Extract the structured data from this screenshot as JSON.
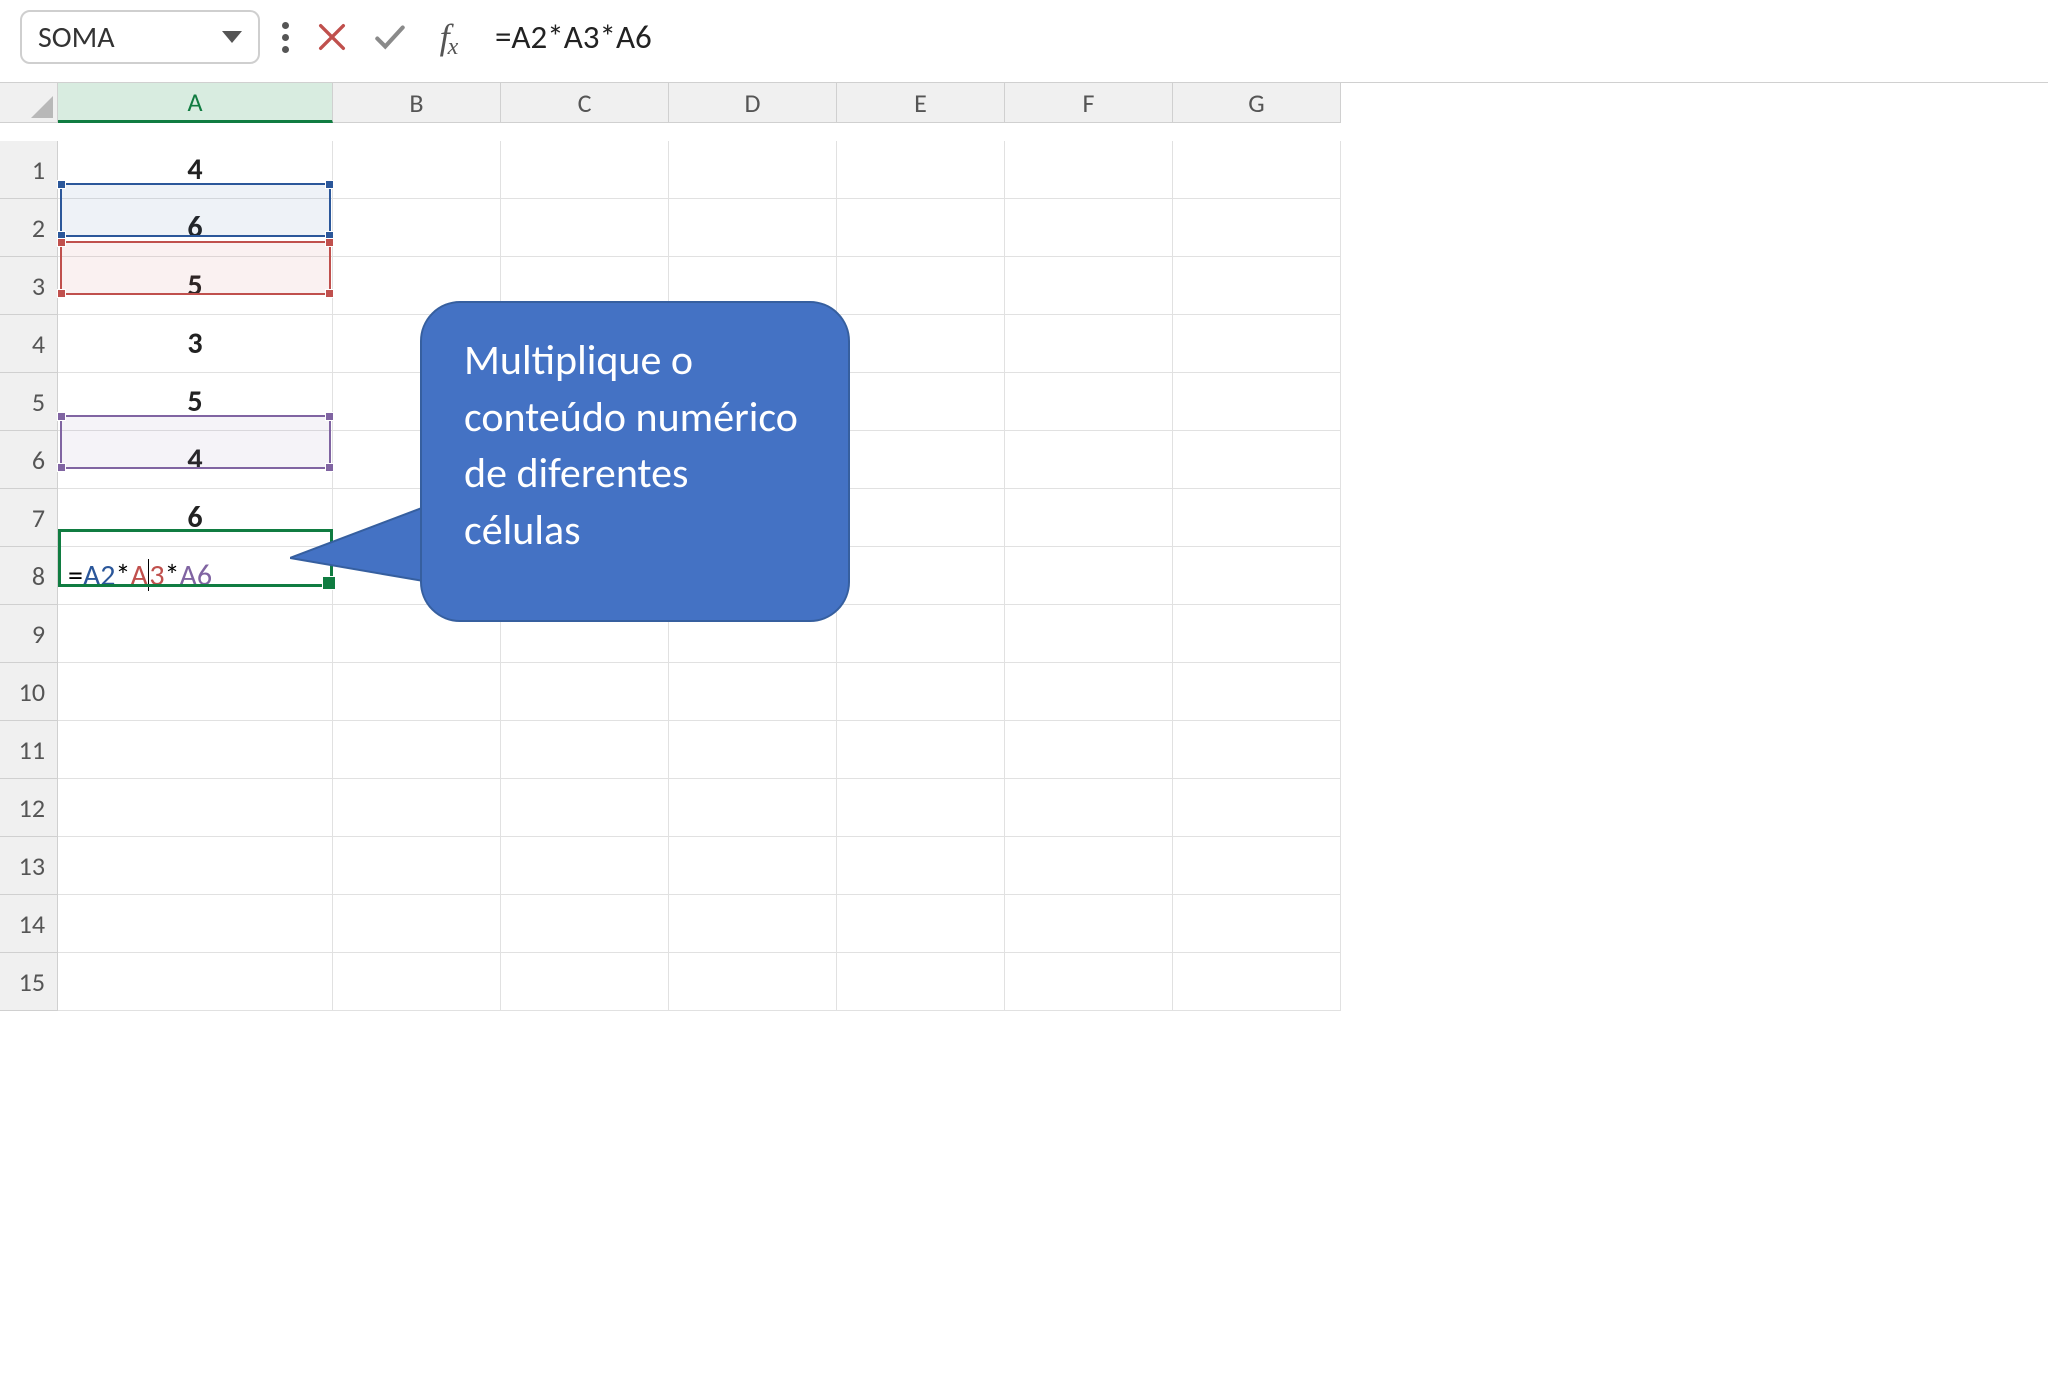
{
  "toolbar": {
    "name_box": "SOMA",
    "formula_text": "=A2*A3*A6"
  },
  "columns": [
    "A",
    "B",
    "C",
    "D",
    "E",
    "F",
    "G"
  ],
  "rows": [
    "1",
    "2",
    "3",
    "4",
    "5",
    "6",
    "7",
    "8",
    "9",
    "10",
    "11",
    "12",
    "13",
    "14",
    "15"
  ],
  "cells": {
    "A1": "4",
    "A2": "6",
    "A3": "5",
    "A4": "3",
    "A5": "5",
    "A6": "4",
    "A7": "6"
  },
  "formula_parts": {
    "eq": "=",
    "r1": "A2",
    "op": "*",
    "r2a": "A",
    "r2b": "3",
    "r3": "A6"
  },
  "callout_text": "Multiplique o conteúdo numérico de diferentes células",
  "colors": {
    "excel_green": "#107c41",
    "ref_blue": "#2b579a",
    "ref_red": "#c0504d",
    "ref_purple": "#8064a2",
    "callout_bg": "#4472c4"
  }
}
